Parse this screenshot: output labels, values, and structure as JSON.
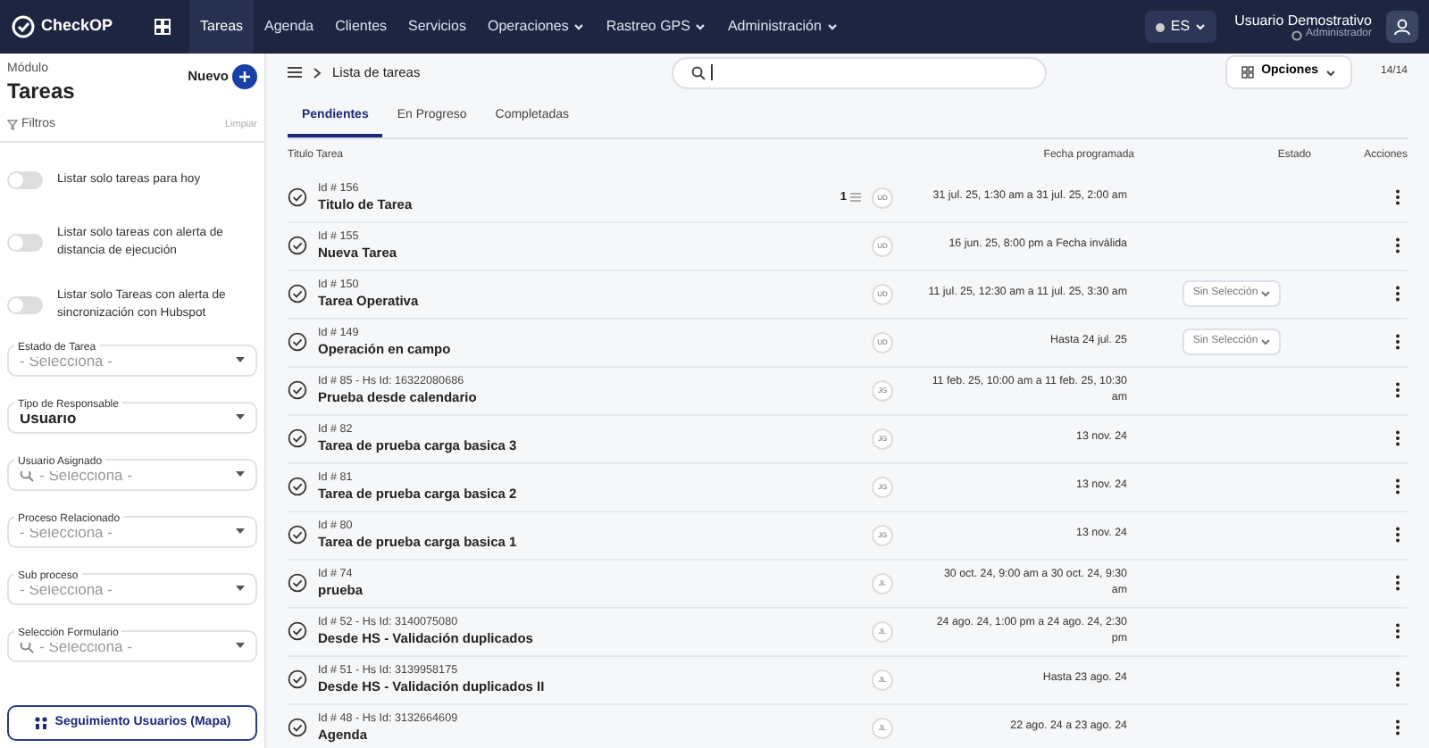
{
  "navbar": {
    "brand": "CheckOP",
    "items": [
      {
        "label": "Tareas",
        "selected": true,
        "dropdown": false
      },
      {
        "label": "Agenda",
        "selected": false,
        "dropdown": false
      },
      {
        "label": "Clientes",
        "selected": false,
        "dropdown": false
      },
      {
        "label": "Servicios",
        "selected": false,
        "dropdown": false
      },
      {
        "label": "Operaciones",
        "selected": false,
        "dropdown": true
      },
      {
        "label": "Rastreo GPS",
        "selected": false,
        "dropdown": true
      },
      {
        "label": "Administración",
        "selected": false,
        "dropdown": true
      }
    ],
    "language": "ES",
    "user": {
      "name": "Usuario Demostrativo",
      "role": "Administrador"
    }
  },
  "sidebar": {
    "module_label": "Módulo",
    "module": "Tareas",
    "new_button": "Nuevo",
    "filters_label": "Filtros",
    "clear_label": "Limpiar",
    "toggles": [
      {
        "label": "Listar solo tareas para hoy",
        "on": false
      },
      {
        "label": "Listar solo tareas con alerta de distancia de ejecución",
        "on": false
      },
      {
        "label": "Listar solo Tareas con alerta de sincronización con Hubspot",
        "on": false
      }
    ],
    "selects": [
      {
        "label": "Estado de Tarea",
        "placeholder": "- Selecciona -",
        "search": false
      },
      {
        "label": "Tipo de Responsable",
        "value": "Usuario",
        "search": false
      },
      {
        "label": "Usuario Asignado",
        "placeholder": "- Selecciona -",
        "search": true
      },
      {
        "label": "Proceso Relacionado",
        "placeholder": "- Selecciona -",
        "search": false
      },
      {
        "label": "Sub proceso",
        "placeholder": "- Selecciona -",
        "search": false
      },
      {
        "label": "Selección Formulario",
        "placeholder": "- Selecciona -",
        "search": true
      }
    ],
    "map_button": "Seguimiento Usuarios (Mapa)"
  },
  "header": {
    "breadcrumb": "Lista de tareas",
    "options_button": "Opciones",
    "count": "14/14"
  },
  "tabs": [
    {
      "label": "Pendientes",
      "selected": true
    },
    {
      "label": "En Progreso",
      "selected": false
    },
    {
      "label": "Completadas",
      "selected": false
    }
  ],
  "table": {
    "columns": [
      "Titulo Tarea",
      "Fecha programada",
      "Estado",
      "Acciones"
    ],
    "rows": [
      {
        "id": "Id # 156",
        "title": "Titulo de Tarea",
        "count": "1",
        "avatar": "UD",
        "date": "31 jul. 25, 1:30 am a 31 jul. 25, 2:00 am"
      },
      {
        "id": "Id # 155",
        "title": "Nueva Tarea",
        "avatar": "UD",
        "date": "16 jun. 25, 8:00 pm a Fecha inválida"
      },
      {
        "id": "Id # 150",
        "title": "Tarea Operativa",
        "avatar": "UD",
        "date": "11 jul. 25, 12:30 am a 11 jul. 25, 3:30 am",
        "status": "Sin Selección"
      },
      {
        "id": "Id # 149",
        "title": "Operación en campo",
        "avatar": "UD",
        "date": "Hasta 24 jul. 25",
        "status": "Sin Selección"
      },
      {
        "id": "Id # 85 - Hs Id: 16322080686",
        "title": "Prueba desde calendario",
        "avatar": "JG",
        "date": "11 feb. 25, 10:00 am a 11 feb. 25, 10:30 am"
      },
      {
        "id": "Id # 82",
        "title": "Tarea de prueba carga basica 3",
        "avatar": "JG",
        "date": "13 nov. 24"
      },
      {
        "id": "Id # 81",
        "title": "Tarea de prueba carga basica 2",
        "avatar": "JG",
        "date": "13 nov. 24"
      },
      {
        "id": "Id # 80",
        "title": "Tarea de prueba carga basica 1",
        "avatar": "JG",
        "date": "13 nov. 24"
      },
      {
        "id": "Id # 74",
        "title": "prueba",
        "avatar": "JL",
        "date": "30 oct. 24, 9:00 am a 30 oct. 24, 9:30 am"
      },
      {
        "id": "Id # 52 - Hs Id: 3140075080",
        "title": "Desde HS - Validación duplicados",
        "avatar": "JL",
        "date": "24 ago. 24, 1:00 pm a 24 ago. 24, 2:30 pm"
      },
      {
        "id": "Id # 51 - Hs Id: 3139958175",
        "title": "Desde HS - Validación duplicados II",
        "avatar": "JL",
        "date": "Hasta 23 ago. 24"
      },
      {
        "id": "Id # 48 - Hs Id: 3132664609",
        "title": "Agenda",
        "avatar": "JL",
        "date": "22 ago. 24 a 23 ago. 24"
      }
    ]
  }
}
